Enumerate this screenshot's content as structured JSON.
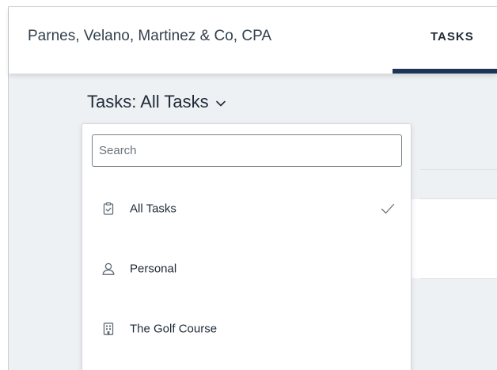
{
  "header": {
    "firm_name": "Parnes, Velano, Martinez & Co, CPA",
    "tab_label": "TASKS"
  },
  "page": {
    "title": "Tasks: All Tasks"
  },
  "dropdown": {
    "search_placeholder": "Search",
    "search_value": "",
    "selected": "All Tasks",
    "options": [
      {
        "label": "All Tasks",
        "icon": "clipboard-check-icon",
        "selected": true
      },
      {
        "label": "Personal",
        "icon": "person-icon",
        "selected": false
      },
      {
        "label": "The Golf Course",
        "icon": "building-icon",
        "selected": false
      }
    ]
  },
  "colors": {
    "accent": "#1d3557",
    "text": "#1f2a36",
    "content_bg": "#eef1f4",
    "icon": "#5f6b76"
  }
}
